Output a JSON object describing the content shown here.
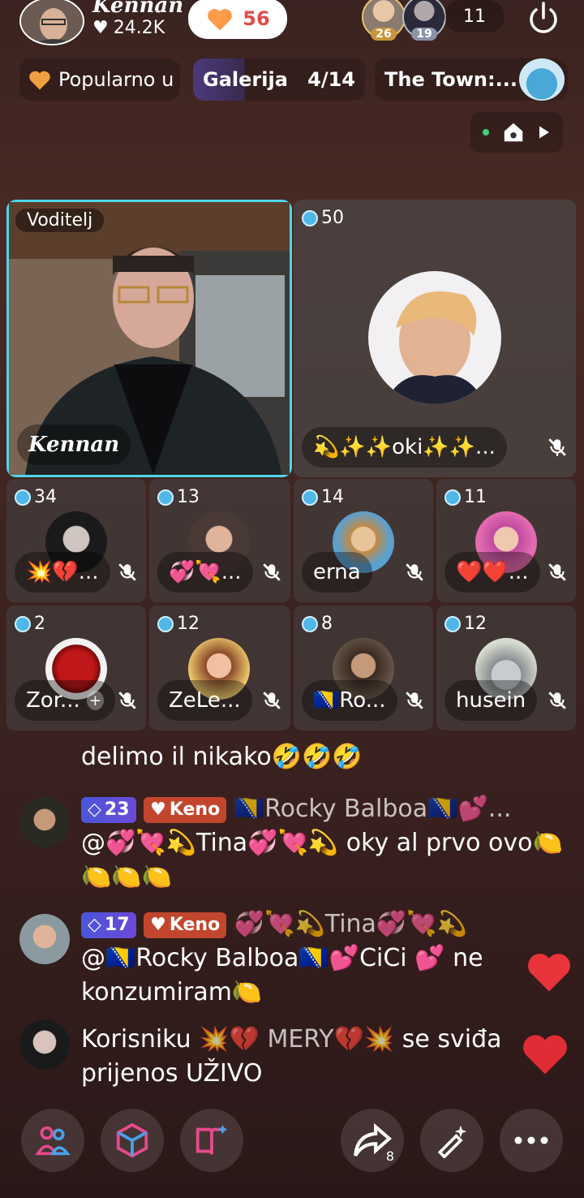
{
  "header": {
    "host_name": "Kennan",
    "host_likes": "24.2K",
    "like_count": "56",
    "viewer_badges": [
      "26",
      "19"
    ],
    "viewer_count": "11"
  },
  "tags": {
    "popular": "Popularno u",
    "gallery_label": "Galerija",
    "gallery_count": "4/14",
    "town": "The Town:..."
  },
  "grid": {
    "host_label": "Voditelj",
    "host_name": "Kennan",
    "guest_badge": "50",
    "guest_name": "💫✨✨oki✨✨...",
    "seats": [
      {
        "badge": "34",
        "name": "💥💔..."
      },
      {
        "badge": "13",
        "name": "💞💘..."
      },
      {
        "badge": "14",
        "name": "erna"
      },
      {
        "badge": "11",
        "name": "❤️❤️..."
      },
      {
        "badge": "2",
        "name": "Zor..."
      },
      {
        "badge": "12",
        "name": "ZeLe..."
      },
      {
        "badge": "8",
        "name": "🇧🇦Ro..."
      },
      {
        "badge": "12",
        "name": "husein"
      }
    ]
  },
  "chat": {
    "line0": "delimo il nikako🤣🤣🤣",
    "m1_level": "23",
    "m1_fan": "Keno",
    "m1_user": "🇧🇦Rocky Balboa🇧🇦💕...",
    "m1_text": "@💞💘💫Tina💞💘💫 oky al prvo ovo🍋🍋🍋🍋",
    "m2_level": "17",
    "m2_fan": "Keno",
    "m2_user": "💞💘💫Tina💞💘💫",
    "m2_text": "@🇧🇦Rocky Balboa🇧🇦💕CiCi 💕 ne konzumiram🍋",
    "m3_prefix": "Korisniku",
    "m3_user": "💥💔 MERY💔💥",
    "m3_suffix": "se sviđa prijenos UŽIVO"
  },
  "bottom": {
    "share_count": "8"
  },
  "colors": {
    "accent_cyan": "#4fd4e8",
    "like_red": "#e04c4c",
    "level_blue": "#4a56d8",
    "fan_red": "#c2462e"
  }
}
